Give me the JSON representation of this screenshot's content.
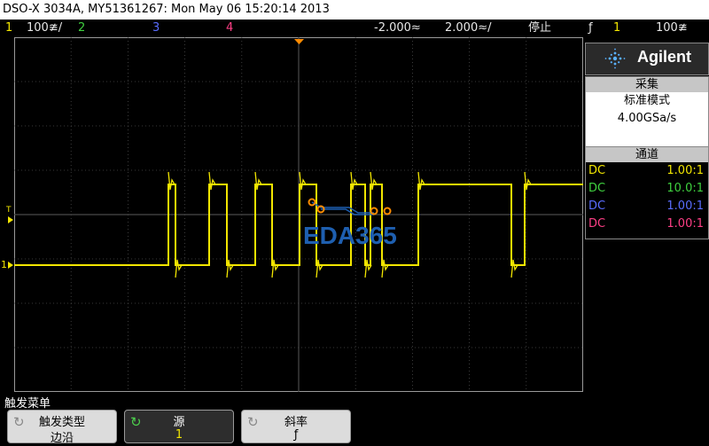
{
  "title_bar": {
    "text": "DSO-X 3034A, MY51361267: Mon May 06 15:20:14 2013"
  },
  "status": {
    "ch1_num": "1",
    "ch1_scale": "100≇/",
    "ch2_num": "2",
    "ch3_num": "3",
    "ch4_num": "4",
    "time_delay": "-2.000≈",
    "time_scale": "2.000≈/",
    "run_state": "停止",
    "trig_icon": "ƒ",
    "trig_src": "1",
    "trig_level": "100≇"
  },
  "markers": {
    "trig_level_label": "T",
    "ch1_ground_label": "1"
  },
  "brand": {
    "name": "Agilent",
    "logo_icon": "spark-icon"
  },
  "acquisition": {
    "header": "采集",
    "mode": "标准模式",
    "rate": "4.00GSa/s"
  },
  "channels": {
    "header": "通道",
    "rows": [
      {
        "coupling": "DC",
        "probe": "1.00:1",
        "color": "#f2e600"
      },
      {
        "coupling": "DC",
        "probe": "10.0:1",
        "color": "#3fd13f"
      },
      {
        "coupling": "DC",
        "probe": "1.00:1",
        "color": "#5a6dff"
      },
      {
        "coupling": "DC",
        "probe": "1.00:1",
        "color": "#ff3f86"
      }
    ]
  },
  "watermark": {
    "text": "EDA365"
  },
  "menu": {
    "title": "触发菜单",
    "softkeys": [
      {
        "label": "触发类型",
        "value": "边沿",
        "icon": "rotate-icon",
        "active": false
      },
      {
        "label": "源",
        "value": "1",
        "icon": "rotate-icon",
        "active": true
      },
      {
        "label": "斜率",
        "value": "ƒ",
        "icon": "rotate-icon",
        "active": false
      }
    ]
  },
  "colors": {
    "trace": "#f2e600",
    "grid": "#4a4a4a",
    "trigger_marker": "#ff8c00"
  }
}
